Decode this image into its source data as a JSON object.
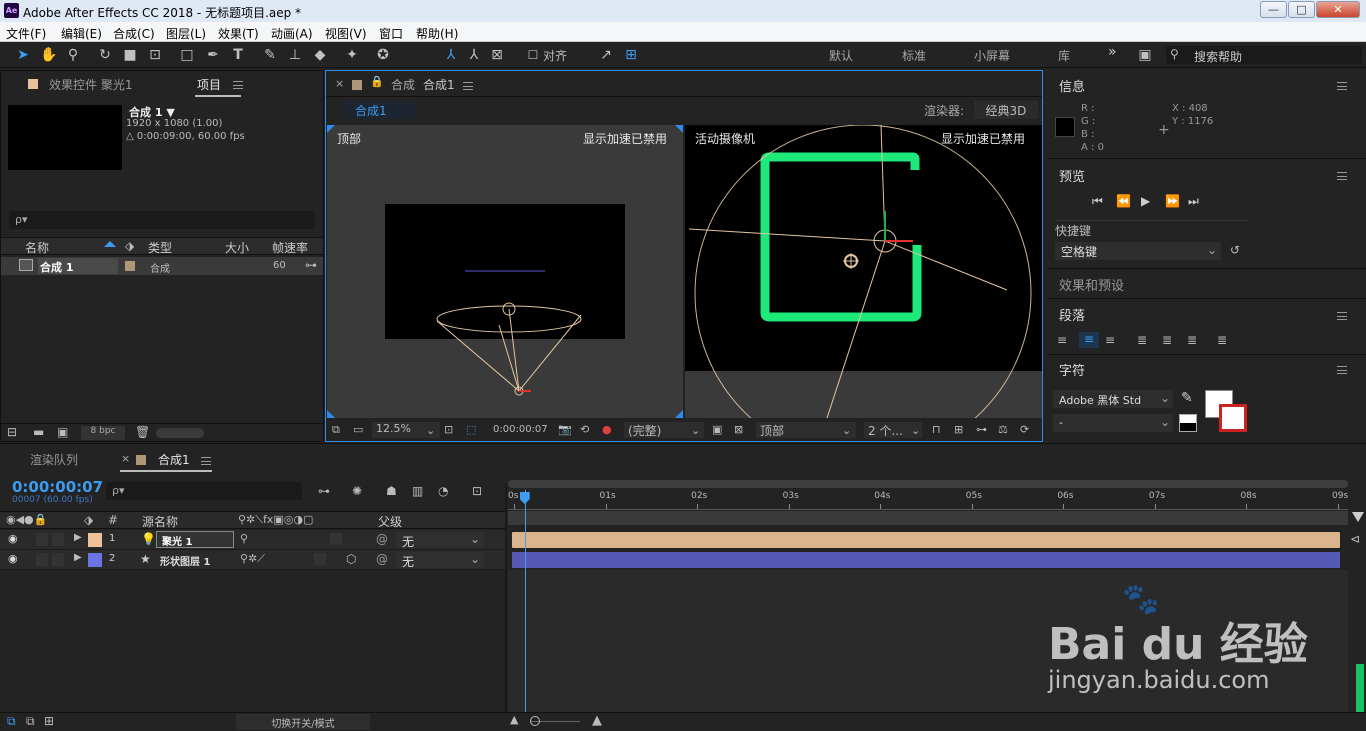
{
  "window": {
    "logo": "Ae",
    "title": "Adobe After Effects CC 2018 - 无标题项目.aep *",
    "min_glyph": "—",
    "max_glyph": "□",
    "close_glyph": "✕"
  },
  "menu": [
    "文件(F)",
    "编辑(E)",
    "合成(C)",
    "图层(L)",
    "效果(T)",
    "动画(A)",
    "视图(V)",
    "窗口",
    "帮助(H)"
  ],
  "toolbar": {
    "align_label": "对齐",
    "workspaces": [
      "默认",
      "标准",
      "小屏幕",
      "库"
    ],
    "more": "»",
    "search_placeholder": "搜索帮助"
  },
  "project_panel": {
    "tab_effects": "效果控件 聚光1",
    "tab_project": "项目",
    "comp_name": "合成 1 ▼",
    "comp_res": "1920 x 1080 (1.00)",
    "comp_dur": "△ 0:00:09:00, 60.00 fps",
    "search_placeholder": "ρ▾",
    "columns": [
      "名称",
      "类型",
      "大小",
      "帧速率"
    ],
    "items": [
      {
        "name": "合成 1",
        "type": "合成",
        "size": "",
        "fps": "60"
      }
    ],
    "bpc": "8 bpc"
  },
  "comp_panel": {
    "tab_label": "合成",
    "tab_name": "合成1",
    "breadcrumb": "合成1",
    "renderer_label": "渲染器:",
    "renderer_value": "经典3D",
    "left_view": "顶部",
    "right_view": "活动摄像机",
    "accel_msg": "显示加速已禁用",
    "zoom": "12.5%",
    "timecode": "0:00:00:07",
    "quality": "(完整)",
    "view_select": "顶部",
    "views_count": "2 个..."
  },
  "info_panel": {
    "title": "信息",
    "r": "R :",
    "g": "G :",
    "b": "B :",
    "a": "A : 0",
    "x": "X : 408",
    "y": "Y : 1176",
    "swatch_color": "#000000"
  },
  "preview_panel": {
    "title": "预览",
    "shortcut_label": "快捷键",
    "shortcut_value": "空格键"
  },
  "effects_presets": {
    "title": "效果和预设"
  },
  "paragraph_panel": {
    "title": "段落"
  },
  "character_panel": {
    "title": "字符",
    "font": "Adobe 黑体 Std",
    "style": "-"
  },
  "timeline": {
    "tab_render": "渲染队列",
    "tab_comp": "合成1",
    "timecode": "0:00:00:07",
    "frames": "00007 (60.00 fps)",
    "search_placeholder": "ρ▾",
    "col_num": "#",
    "col_source": "源名称",
    "col_parent": "父级",
    "ruler": [
      "0s",
      "01s",
      "02s",
      "03s",
      "04s",
      "05s",
      "06s",
      "07s",
      "08s",
      "09s"
    ],
    "playhead_fraction": 0.013,
    "layers": [
      {
        "num": "1",
        "name": "聚光 1",
        "color": "#f0c39a",
        "parent": "无",
        "bar_color": "#d9b48c"
      },
      {
        "num": "2",
        "name": "形状图层 1",
        "color": "#6b74e0",
        "parent": "无",
        "bar_color": "#565ab4"
      }
    ],
    "toggle_mode": "切换开关/模式"
  },
  "colors": {
    "accent": "#2d8ceb",
    "green_shape": "#1de87a"
  },
  "watermark": {
    "brand": "Bai du 经验",
    "url": "jingyan.baidu.com"
  }
}
